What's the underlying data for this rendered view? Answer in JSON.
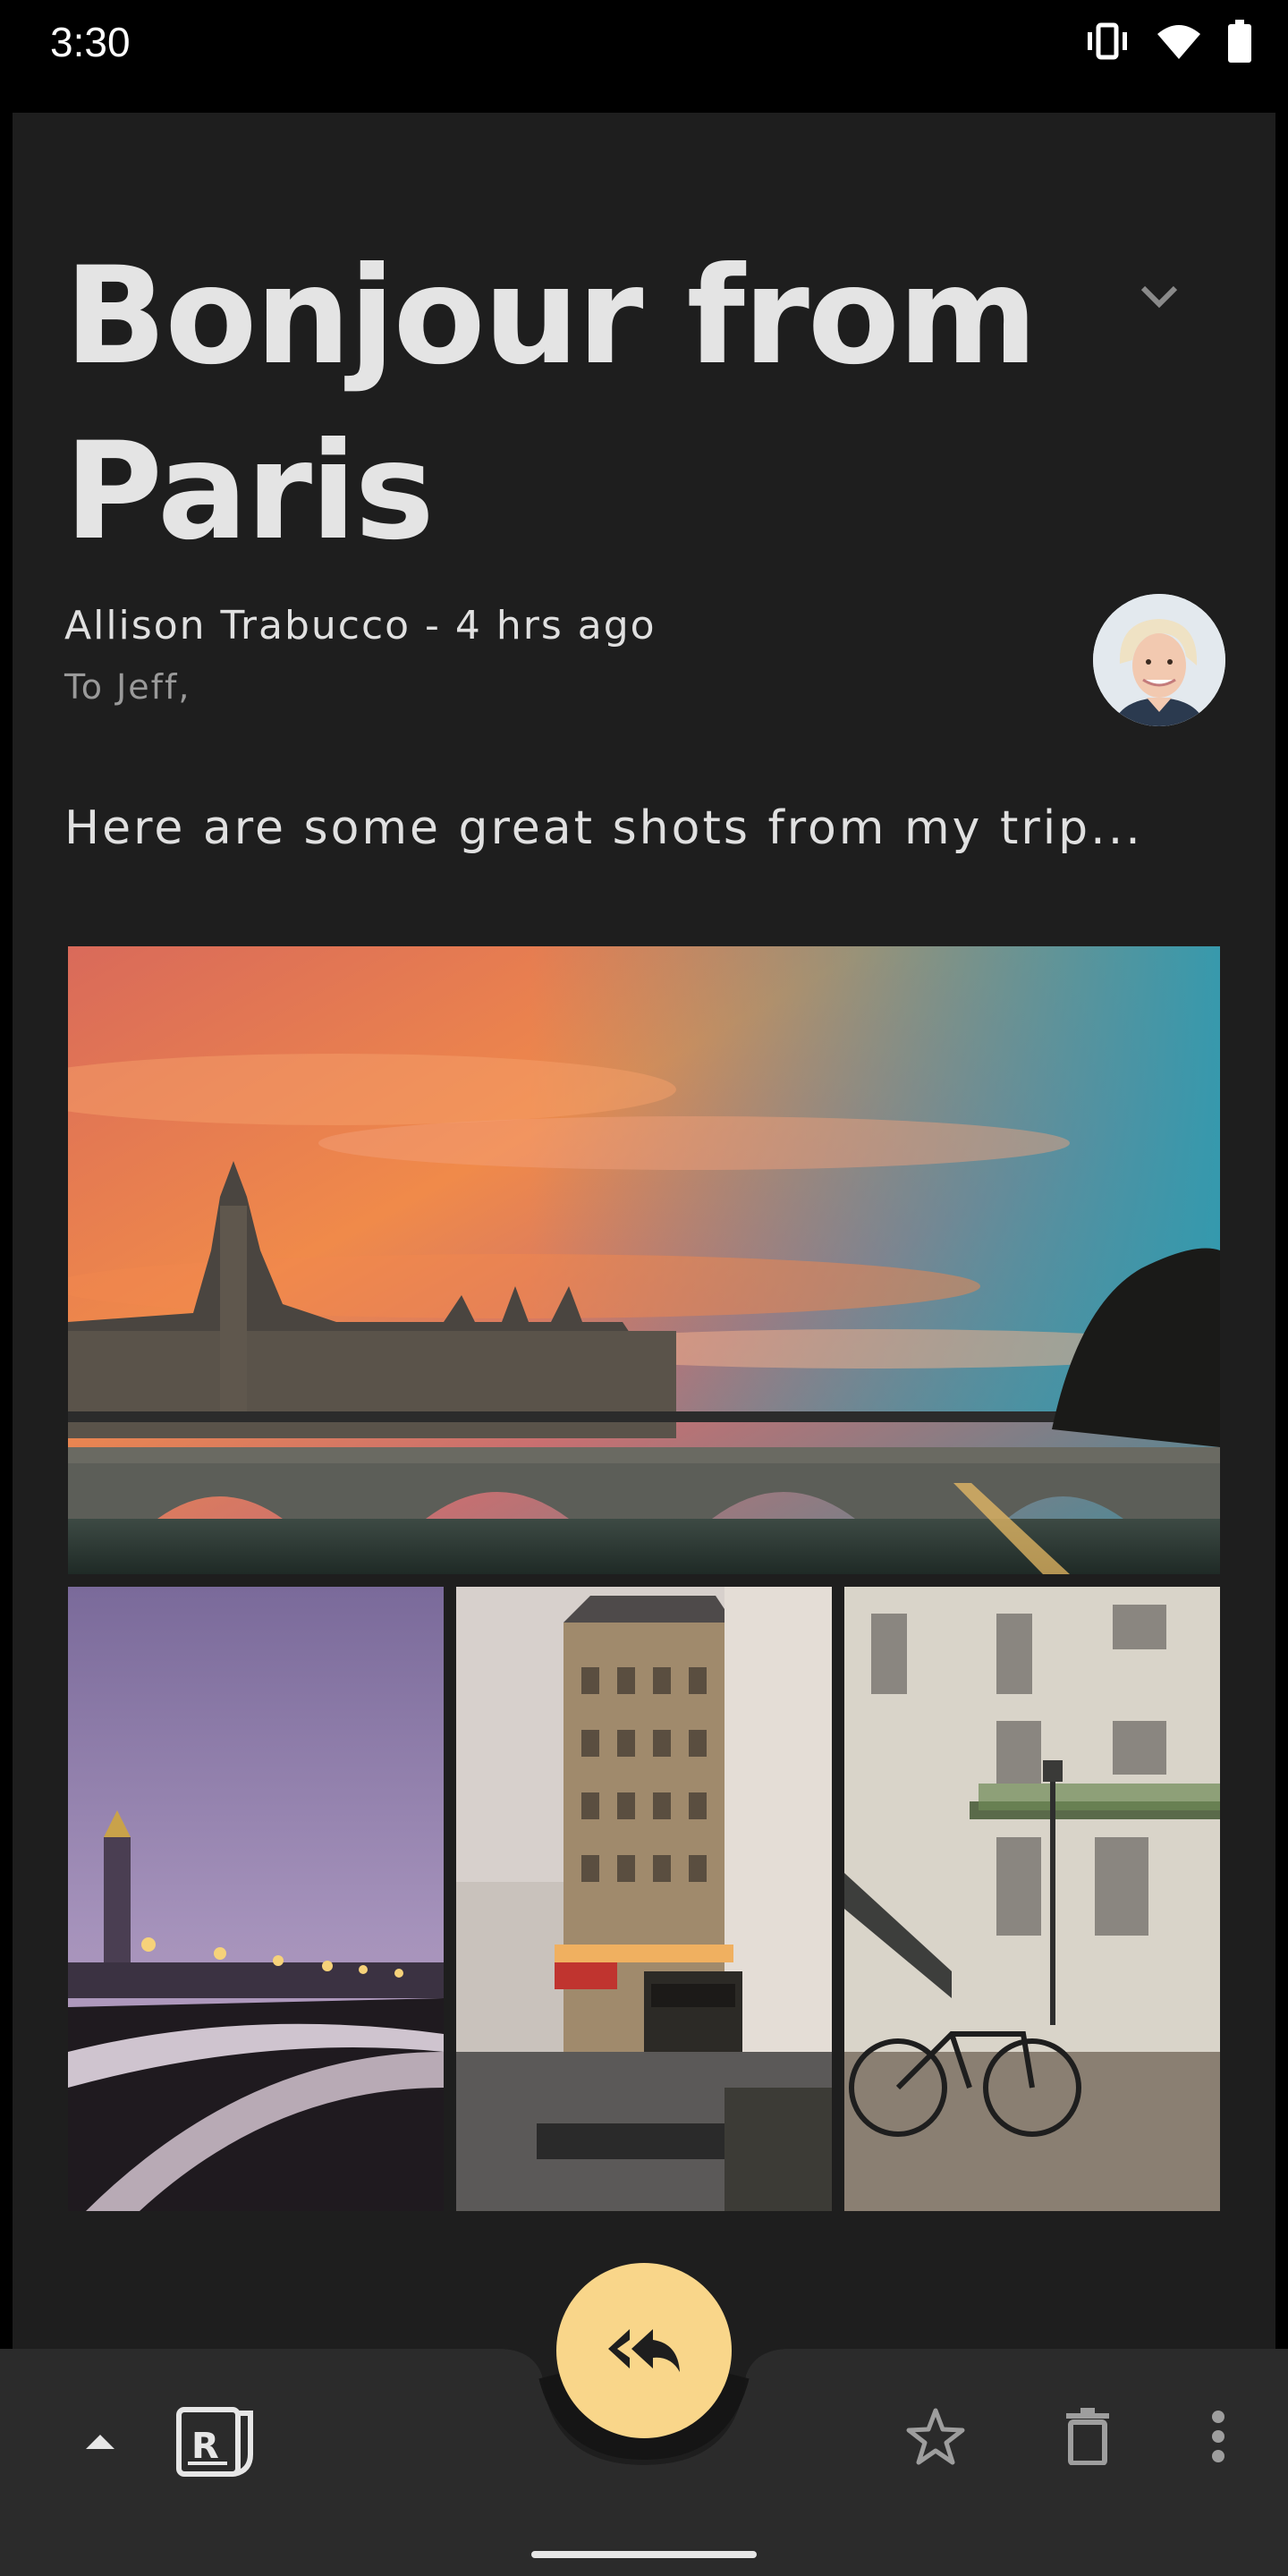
{
  "status_bar": {
    "time": "3:30"
  },
  "email": {
    "subject": "Bonjour from Paris",
    "sender": "Allison Trabucco - 4 hrs ago",
    "recipient": "To Jeff,",
    "body": "Here are some great shots from my trip..."
  },
  "photos": {
    "featured": "Conciergerie at sunset",
    "grid": [
      "Pont Alexandre III at dusk",
      "Metropolitain street corner",
      "Bicycle by Parisian building"
    ]
  },
  "actions": {
    "reply_all": "reply-all-icon",
    "expand": "chevron-up-icon",
    "app_logo": "reply-logo-icon",
    "star": "star-icon",
    "delete": "trash-icon",
    "more": "more-vert-icon"
  },
  "colors": {
    "background": "#1e1e1e",
    "bottom_bar": "#2b2b2b",
    "fab": "#f9d68a"
  }
}
